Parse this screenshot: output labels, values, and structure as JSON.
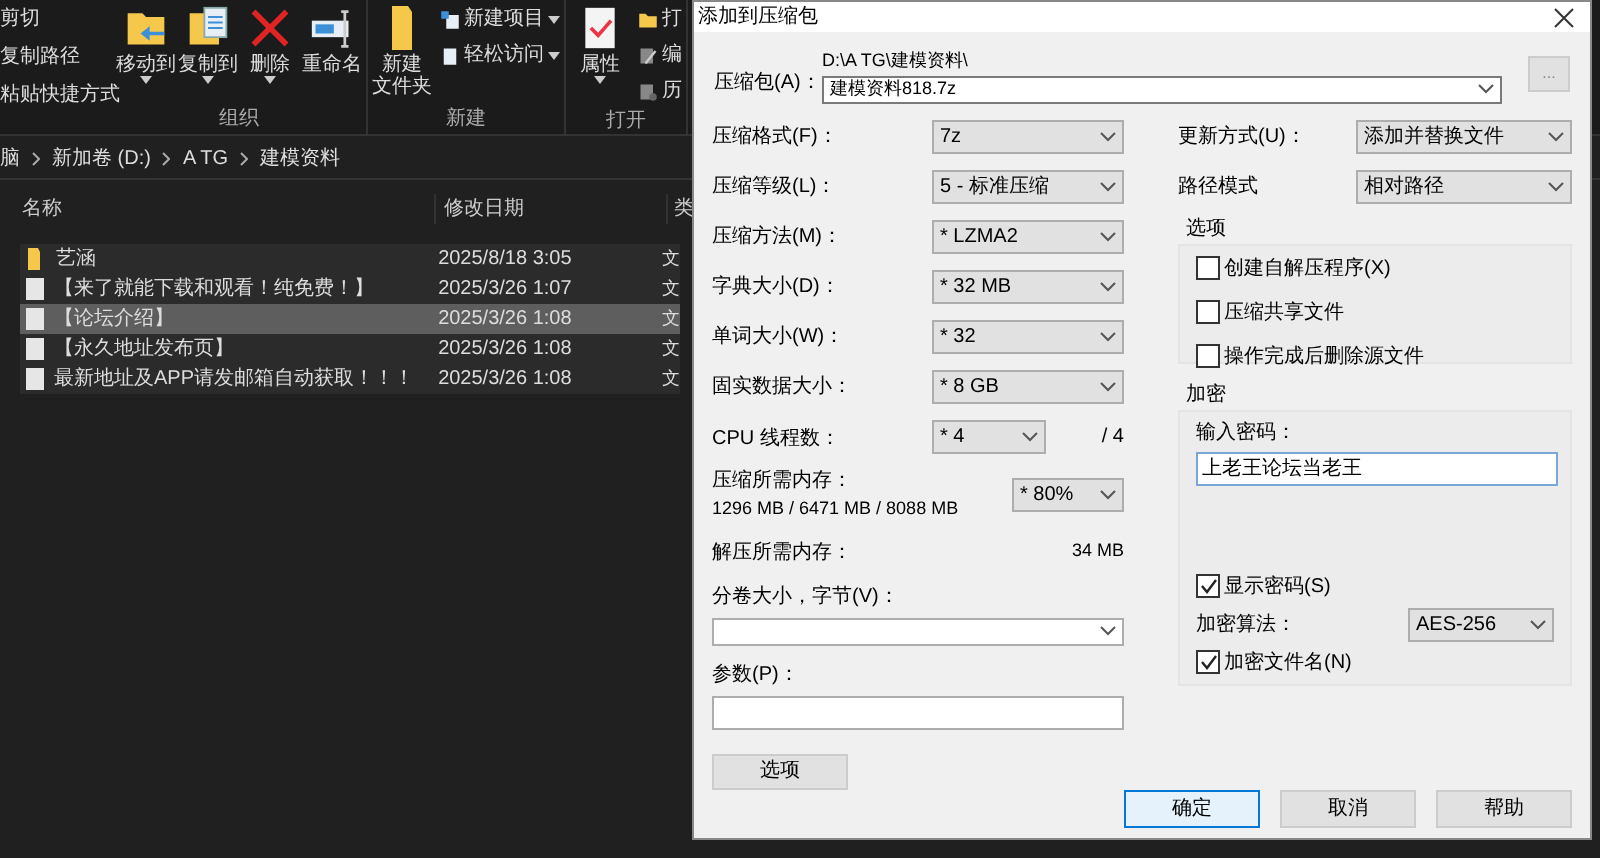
{
  "explorer": {
    "clipboard_items": [
      "剪切",
      "复制路径",
      "粘贴快捷方式"
    ],
    "groups": [
      {
        "label": "组织",
        "buttons": [
          {
            "lines": [
              "移动到"
            ],
            "menu": true
          },
          {
            "lines": [
              "复制到"
            ],
            "menu": true
          },
          {
            "lines": [
              "删除"
            ],
            "menu": true
          },
          {
            "lines": [
              "重命名"
            ],
            "menu": false
          }
        ]
      },
      {
        "label": "新建",
        "buttons": [
          {
            "lines": [
              "新建",
              "文件夹"
            ],
            "menu": false
          }
        ],
        "menu_items": [
          {
            "label": "新建项目",
            "menu": true
          },
          {
            "label": "轻松访问",
            "menu": true
          }
        ]
      },
      {
        "label": "打开",
        "buttons": [
          {
            "lines": [
              "属性"
            ],
            "menu": true
          }
        ],
        "menu_items": [
          {
            "label": "打",
            "menu": false
          },
          {
            "label": "编",
            "menu": false
          },
          {
            "label": "历",
            "menu": false
          }
        ]
      }
    ],
    "breadcrumb": [
      "脑",
      "新加卷 (D:)",
      "A TG",
      "建模资料"
    ],
    "columns": [
      "名称",
      "修改日期",
      "类"
    ],
    "rows": [
      {
        "name": "艺涵",
        "kind": "folder",
        "date": "2025/8/18 3:05",
        "type": "文",
        "selected": false
      },
      {
        "name": "【来了就能下载和观看！纯免费！】",
        "kind": "file",
        "date": "2025/3/26 1:07",
        "type": "文",
        "selected": false
      },
      {
        "name": "【论坛介绍】",
        "kind": "file",
        "date": "2025/3/26 1:08",
        "type": "文",
        "selected": true
      },
      {
        "name": "【永久地址发布页】",
        "kind": "file",
        "date": "2025/3/26 1:08",
        "type": "文",
        "selected": false
      },
      {
        "name": "最新地址及APP请发邮箱自动获取！！！",
        "kind": "file",
        "date": "2025/3/26 1:08",
        "type": "文",
        "selected": false
      }
    ]
  },
  "dialog": {
    "title": "添加到压缩包",
    "archive_label": "压缩包(A)：",
    "archive_path": "D:\\A TG\\建模资料\\",
    "archive_name": "建模资料818.7z",
    "browse_button": "...",
    "left_fields": [
      {
        "kind": "select",
        "label": "压缩格式(F)：",
        "value": "7z"
      },
      {
        "kind": "select",
        "label": "压缩等级(L)：",
        "value": "5 - 标准压缩"
      },
      {
        "kind": "select",
        "label": "压缩方法(M)：",
        "value": "* LZMA2"
      },
      {
        "kind": "select",
        "label": "字典大小(D)：",
        "value": "* 32 MB"
      },
      {
        "kind": "select",
        "label": "单词大小(W)：",
        "value": "* 32"
      },
      {
        "kind": "select",
        "label": "固实数据大小：",
        "value": "* 8 GB"
      },
      {
        "kind": "threads",
        "label": "CPU 线程数：",
        "value": "* 4",
        "suffix": "/ 4"
      },
      {
        "kind": "memory",
        "label": "压缩所需内存：",
        "detail": "1296 MB / 6471 MB / 8088 MB",
        "value": "* 80%"
      },
      {
        "kind": "value",
        "label": "解压所需内存：",
        "value": "34 MB"
      }
    ],
    "volume": {
      "label": "分卷大小，字节(V)："
    },
    "params": {
      "label": "参数(P)："
    },
    "options_button": "选项",
    "update_mode": {
      "label": "更新方式(U)：",
      "value": "添加并替换文件"
    },
    "path_mode": {
      "label": "路径模式",
      "value": "相对路径"
    },
    "options": {
      "title": "选项",
      "checkboxes": [
        {
          "label": "创建自解压程序(X)",
          "checked": false
        },
        {
          "label": "压缩共享文件",
          "checked": false
        },
        {
          "label": "操作完成后删除源文件",
          "checked": false
        }
      ]
    },
    "encryption": {
      "title": "加密",
      "password_label": "输入密码：",
      "password": "上老王论坛当老王",
      "show_password": {
        "label": "显示密码(S)",
        "checked": true
      },
      "method_label": "加密算法：",
      "method": "AES-256",
      "encrypt_names": {
        "label": "加密文件名(N)",
        "checked": true
      }
    },
    "buttons": [
      {
        "label": "确定",
        "default": true
      },
      {
        "label": "取消",
        "default": false
      },
      {
        "label": "帮助",
        "default": false
      }
    ]
  }
}
